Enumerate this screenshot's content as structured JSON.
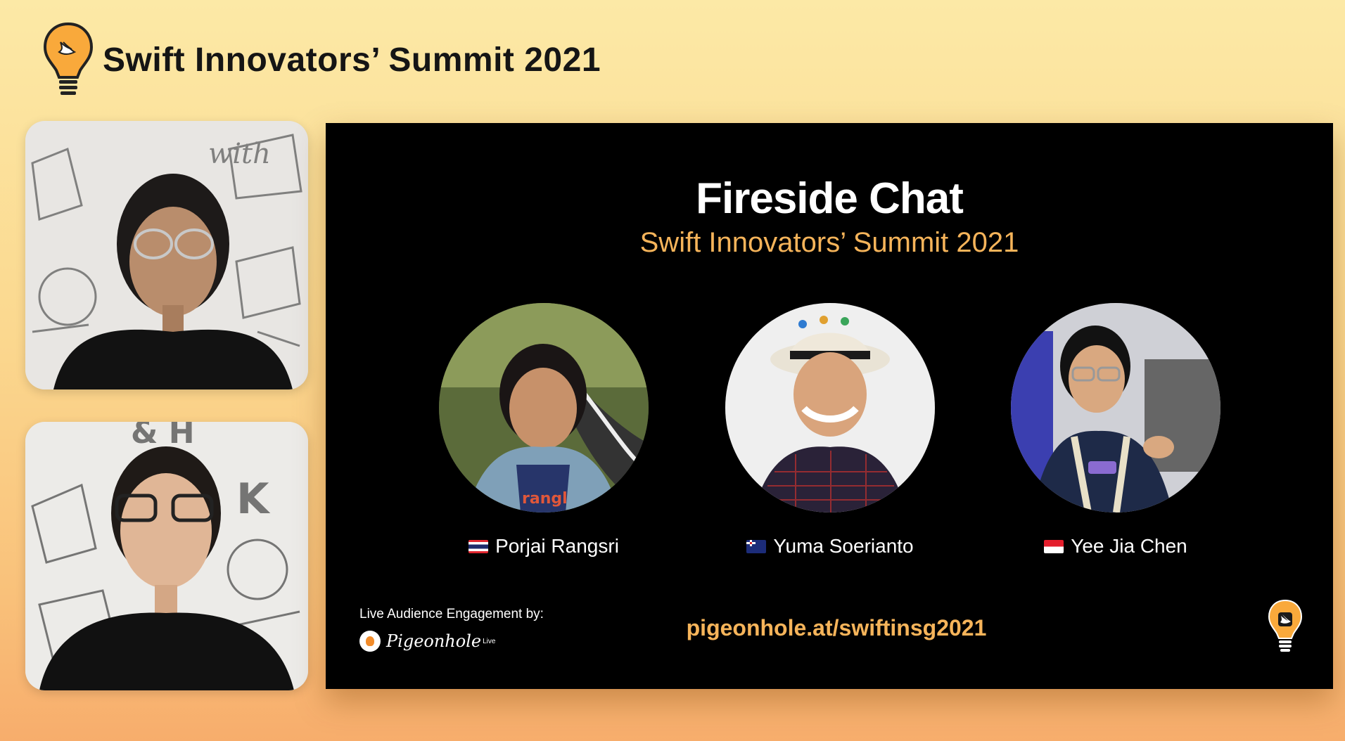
{
  "header": {
    "title": "Swift Innovators’ Summit 2021",
    "logo_icon": "swift-lightbulb-icon"
  },
  "slide": {
    "title": "Fireside Chat",
    "subtitle": "Swift Innovators’ Summit 2021",
    "speakers": [
      {
        "name": "Porjai Rangsri",
        "flag": "thailand-flag-icon"
      },
      {
        "name": "Yuma Soerianto",
        "flag": "australia-flag-icon"
      },
      {
        "name": "Yee Jia Chen",
        "flag": "singapore-flag-icon"
      }
    ],
    "engagement_label": "Live Audience Engagement by:",
    "engagement_brand": "Pigeonhole",
    "engagement_brand_suffix": "Live",
    "url": "pigeonhole.at/swiftinsg2021"
  },
  "colors": {
    "accent": "#f6b45a",
    "background_top": "#fce9a6",
    "background_bottom": "#f7ad6c",
    "slide_background": "#000000"
  }
}
